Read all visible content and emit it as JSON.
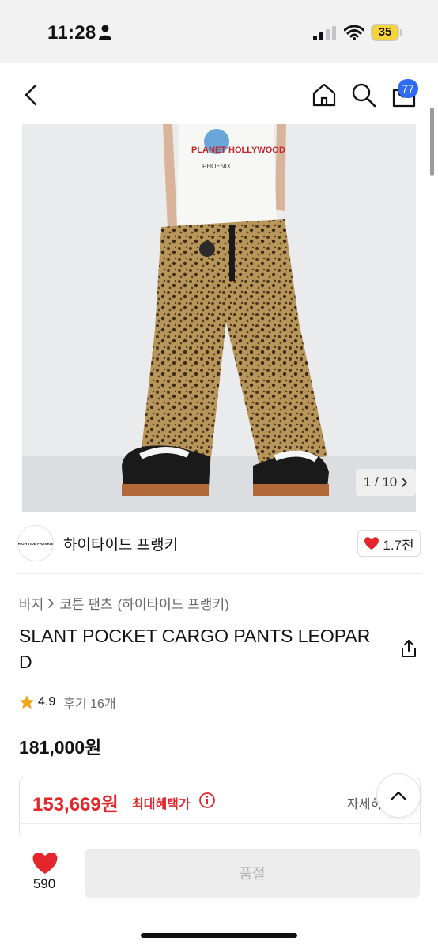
{
  "status_bar": {
    "time": "11:28",
    "battery": "35"
  },
  "header": {
    "cart_count": "77"
  },
  "gallery": {
    "counter": "1 / 10"
  },
  "brand": {
    "logo_text": "HIGH TIDE FRANKIE",
    "name": "하이타이드 프랭키",
    "likes": "1.7천"
  },
  "breadcrumb": {
    "items": [
      "바지",
      "코튼 팬츠",
      "(하이타이드 프랭키)"
    ]
  },
  "product": {
    "title": "SLANT POCKET CARGO PANTS LEOPARD",
    "rating": "4.9",
    "reviews": "후기 16개",
    "price": "181,000원"
  },
  "benefit": {
    "price": "153,669원",
    "label": "최대혜택가",
    "detail": "자세히"
  },
  "bottom": {
    "wish_count": "590",
    "soldout_label": "품절"
  },
  "colors": {
    "accent_red": "#e3262b",
    "badge_blue": "#2f6bf0"
  }
}
